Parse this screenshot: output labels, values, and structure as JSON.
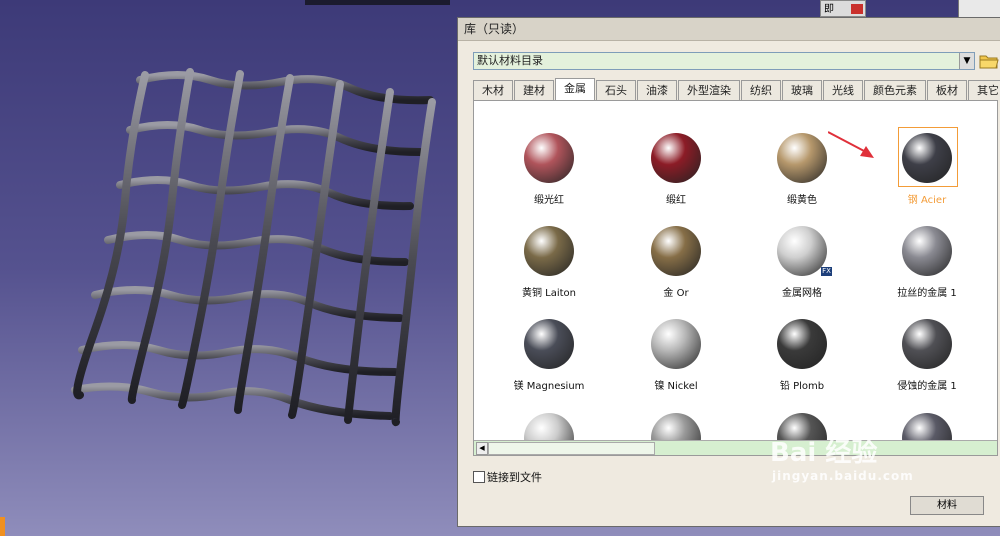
{
  "dialog": {
    "title": "库（只读）",
    "catalog": "默认材料目录",
    "tabs": [
      "木材",
      "建材",
      "金属",
      "石头",
      "油漆",
      "外型渲染",
      "纺织",
      "玻璃",
      "光线",
      "颜色元素",
      "板材",
      "其它"
    ],
    "active_tab": "金属",
    "link_label": "链接到文件",
    "bottom_button": "材料"
  },
  "mini_window": {
    "label": "即"
  },
  "materials": [
    {
      "label": "缎光红",
      "color": "#b0545b"
    },
    {
      "label": "缎红",
      "color": "#8c1c26"
    },
    {
      "label": "缎黄色",
      "color": "#b6986c"
    },
    {
      "label": "钢 Acier",
      "color": "#3e3f48",
      "selected": true
    },
    {
      "label": "黄铜 Laiton",
      "color": "#7a6a48"
    },
    {
      "label": "金 Or",
      "color": "#866e47"
    },
    {
      "label": "金属网格",
      "color": "#cfcfcf",
      "fx": "FX"
    },
    {
      "label": "拉丝的金属 1",
      "color": "#8a8a92"
    },
    {
      "label": "镁 Magnesium",
      "color": "#4a4d58"
    },
    {
      "label": "镍 Nickel",
      "color": "#b8b8b8"
    },
    {
      "label": "铅 Plomb",
      "color": "#3a3a3a"
    },
    {
      "label": "侵蚀的金属 1",
      "color": "#505055"
    }
  ],
  "watermark": {
    "main": "Bai 经验",
    "sub": "jingyan.baidu.com"
  },
  "colors": {
    "selection": "#f39c38",
    "arrow": "#e0303a",
    "background": "#48458a"
  },
  "icons": [
    "folder-icon",
    "arrow-pointer-icon",
    "baidu-paw-icon",
    "mesh-model"
  ]
}
